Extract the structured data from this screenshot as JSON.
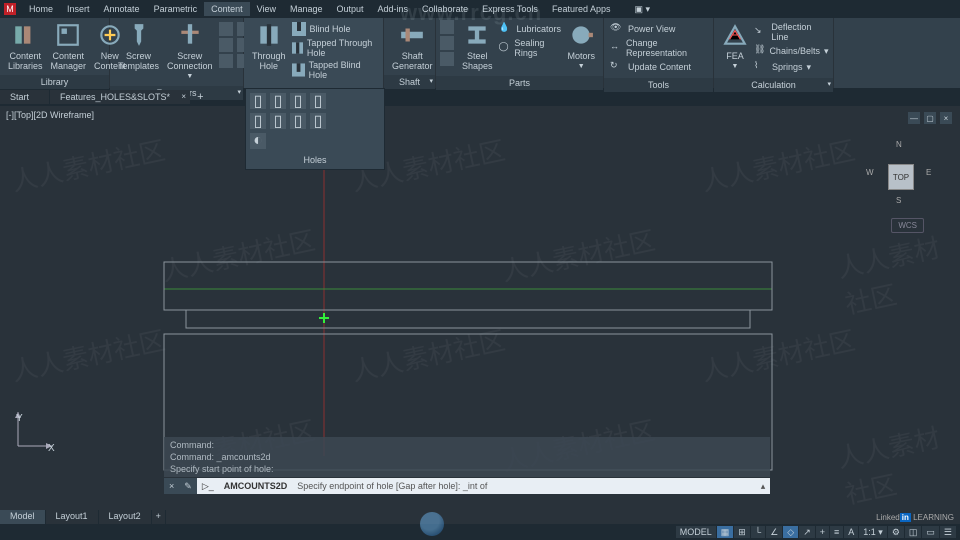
{
  "menu": {
    "app_letter": "M",
    "tabs": [
      "Home",
      "Insert",
      "Annotate",
      "Parametric",
      "Content",
      "View",
      "Manage",
      "Output",
      "Add-ins",
      "Collaborate",
      "Express Tools",
      "Featured Apps"
    ],
    "active_tab": 4
  },
  "ribbon": {
    "library": {
      "title": "Library",
      "content_libraries": "Content\nLibraries",
      "content_manager": "Content\nManager",
      "new_content": "New\nContent"
    },
    "fasteners": {
      "title": "Fasteners",
      "screw_templates": "Screw\nTemplates",
      "screw_connection": "Screw\nConnection"
    },
    "holes_panel": {
      "title": "Holes",
      "through_hole": "Through\nHole",
      "blind_hole": "Blind Hole",
      "tapped_through": "Tapped Through Hole",
      "tapped_blind": "Tapped Blind Hole"
    },
    "shaft_panel": {
      "title": "Shaft",
      "shaft_generator": "Shaft\nGenerator"
    },
    "parts": {
      "title": "Parts",
      "steel_shapes": "Steel\nShapes",
      "lubricators": "Lubricators",
      "sealing_rings": "Sealing Rings",
      "motors": "Motors"
    },
    "tools": {
      "title": "Tools",
      "power_view": "Power View",
      "change_rep": "Change Representation",
      "update_content": "Update Content"
    },
    "calculation": {
      "title": "Calculation",
      "fea": "FEA",
      "deflection": "Deflection Line",
      "chains": "Chains/Belts",
      "springs": "Springs"
    }
  },
  "holes_drop": {
    "label": "Holes"
  },
  "file_tabs": {
    "start": "Start",
    "file": "Features_HOLES&SLOTS*"
  },
  "view_label": "[-][Top][2D Wireframe]",
  "viewcube": {
    "face": "TOP",
    "n": "N",
    "e": "E",
    "s": "S",
    "w": "W",
    "wcs": "WCS"
  },
  "axes": {
    "x": "X",
    "y": "Y"
  },
  "cmd_history": [
    "Command:",
    "Command: _amcounts2d",
    "Specify start point of hole:"
  ],
  "cmd": {
    "name": "AMCOUNTS2D",
    "prompt": "Specify endpoint of hole [Gap after hole]: _int of"
  },
  "bottom_tabs": [
    "Model",
    "Layout1",
    "Layout2"
  ],
  "status": {
    "model": "MODEL"
  },
  "linkedin": {
    "brand": "Linked",
    "in": "in",
    "tag": "LEARNING"
  },
  "url_wm": "www.rrcg.cn",
  "wm_text": "人人素材社区"
}
